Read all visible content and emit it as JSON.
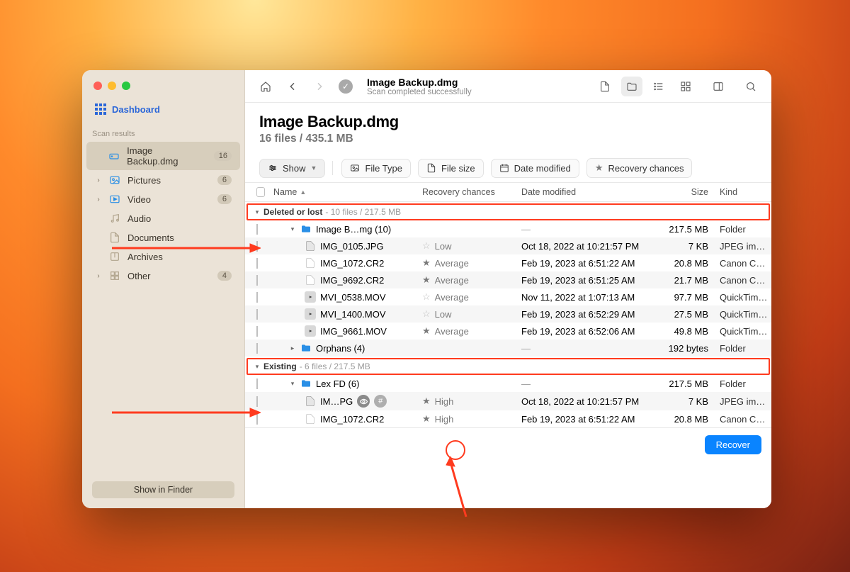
{
  "window": {
    "title": "Image Backup.dmg",
    "subtitle": "Scan completed successfully"
  },
  "sidebar": {
    "dashboard_label": "Dashboard",
    "section_label": "Scan results",
    "items": [
      {
        "icon": "drive",
        "label": "Image Backup.dmg",
        "badge": "16",
        "selected": true,
        "expandable": false
      },
      {
        "icon": "pic",
        "label": "Pictures",
        "badge": "6",
        "expandable": true
      },
      {
        "icon": "vid",
        "label": "Video",
        "badge": "6",
        "expandable": true
      },
      {
        "icon": "audio",
        "label": "Audio",
        "badge": "",
        "expandable": false
      },
      {
        "icon": "doc",
        "label": "Documents",
        "badge": "",
        "expandable": false
      },
      {
        "icon": "arc",
        "label": "Archives",
        "badge": "",
        "expandable": false
      },
      {
        "icon": "oth",
        "label": "Other",
        "badge": "4",
        "expandable": true
      }
    ],
    "finder_button": "Show in Finder"
  },
  "heading": {
    "title": "Image Backup.dmg",
    "subtitle": "16 files / 435.1 MB"
  },
  "filters": {
    "show": "Show",
    "file_type": "File Type",
    "file_size": "File size",
    "date_modified": "Date modified",
    "recovery_chances": "Recovery chances"
  },
  "columns": {
    "name": "Name",
    "recovery": "Recovery chances",
    "date": "Date modified",
    "size": "Size",
    "kind": "Kind"
  },
  "sections": [
    {
      "title": "Deleted or lost",
      "meta": "10 files / 217.5 MB",
      "rows": [
        {
          "indent": 1,
          "chev": "down",
          "icon": "folder",
          "name": "Image B…mg (10)",
          "recovery": "",
          "date": "—",
          "size": "217.5 MB",
          "kind": "Folder",
          "alt": false
        },
        {
          "indent": 2,
          "icon": "jpg",
          "name": "IMG_0105.JPG",
          "recovery": "Low",
          "star": "empty",
          "date": "Oct 18, 2022 at 10:21:57 PM",
          "size": "7 KB",
          "kind": "JPEG ima…",
          "alt": true
        },
        {
          "indent": 2,
          "icon": "raw",
          "name": "IMG_1072.CR2",
          "recovery": "Average",
          "star": "half",
          "date": "Feb 19, 2023 at 6:51:22 AM",
          "size": "20.8 MB",
          "kind": "Canon CR…",
          "alt": false
        },
        {
          "indent": 2,
          "icon": "raw",
          "name": "IMG_9692.CR2",
          "recovery": "Average",
          "star": "half",
          "date": "Feb 19, 2023 at 6:51:25 AM",
          "size": "21.7 MB",
          "kind": "Canon CR…",
          "alt": true
        },
        {
          "indent": 2,
          "icon": "mov",
          "name": "MVI_0538.MOV",
          "recovery": "Average",
          "star": "empty",
          "date": "Nov 11, 2022 at 1:07:13 AM",
          "size": "97.7 MB",
          "kind": "QuickTim…",
          "alt": false
        },
        {
          "indent": 2,
          "icon": "mov",
          "name": "MVI_1400.MOV",
          "recovery": "Low",
          "star": "empty",
          "date": "Feb 19, 2023 at 6:52:29 AM",
          "size": "27.5 MB",
          "kind": "QuickTim…",
          "alt": true
        },
        {
          "indent": 2,
          "icon": "mov",
          "name": "IMG_9661.MOV",
          "recovery": "Average",
          "star": "half",
          "date": "Feb 19, 2023 at 6:52:06 AM",
          "size": "49.8 MB",
          "kind": "QuickTim…",
          "alt": false
        },
        {
          "indent": 1,
          "chev": "right",
          "icon": "folder",
          "name": "Orphans (4)",
          "recovery": "",
          "date": "—",
          "size": "192 bytes",
          "kind": "Folder",
          "alt": true
        }
      ]
    },
    {
      "title": "Existing",
      "meta": "6 files / 217.5 MB",
      "rows": [
        {
          "indent": 1,
          "chev": "down",
          "icon": "folder",
          "name": "Lex FD (6)",
          "recovery": "",
          "date": "—",
          "size": "217.5 MB",
          "kind": "Folder",
          "alt": false
        },
        {
          "indent": 2,
          "icon": "jpg",
          "name": "IM…PG",
          "recovery": "High",
          "star": "fill",
          "preview": true,
          "date": "Oct 18, 2022 at 10:21:57 PM",
          "size": "7 KB",
          "kind": "JPEG ima…",
          "alt": true
        },
        {
          "indent": 2,
          "icon": "raw",
          "name": "IMG_1072.CR2",
          "recovery": "High",
          "star": "fill",
          "date": "Feb 19, 2023 at 6:51:22 AM",
          "size": "20.8 MB",
          "kind": "Canon CR…",
          "alt": false
        }
      ]
    }
  ],
  "footer": {
    "recover": "Recover"
  }
}
